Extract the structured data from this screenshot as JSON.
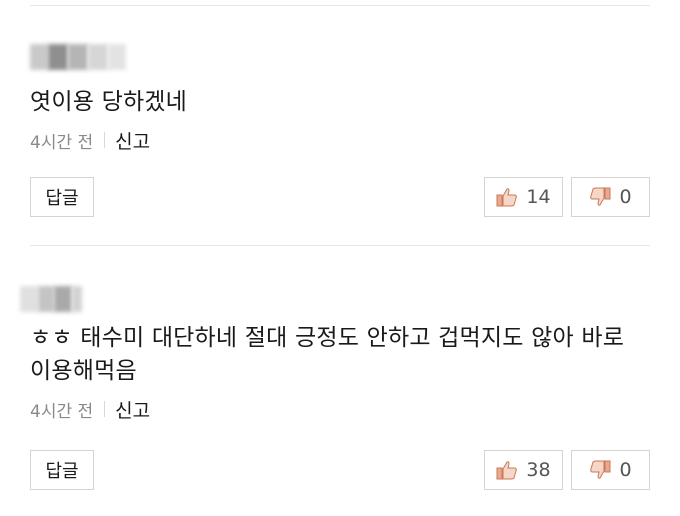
{
  "comments": [
    {
      "text": "엿이용 당하겠네",
      "time": "4시간 전",
      "report": "신고",
      "reply": "답글",
      "likes": "14",
      "dislikes": "0"
    },
    {
      "text": "ㅎㅎ 태수미 대단하네 절대 긍정도 안하고 겁먹지도 않아 바로 이용해먹음",
      "time": "4시간 전",
      "report": "신고",
      "reply": "답글",
      "likes": "38",
      "dislikes": "0"
    }
  ],
  "colors": {
    "like_icon": "#e08a6a",
    "dislike_icon": "#e08a6a",
    "divider": "#e8e8e8"
  }
}
